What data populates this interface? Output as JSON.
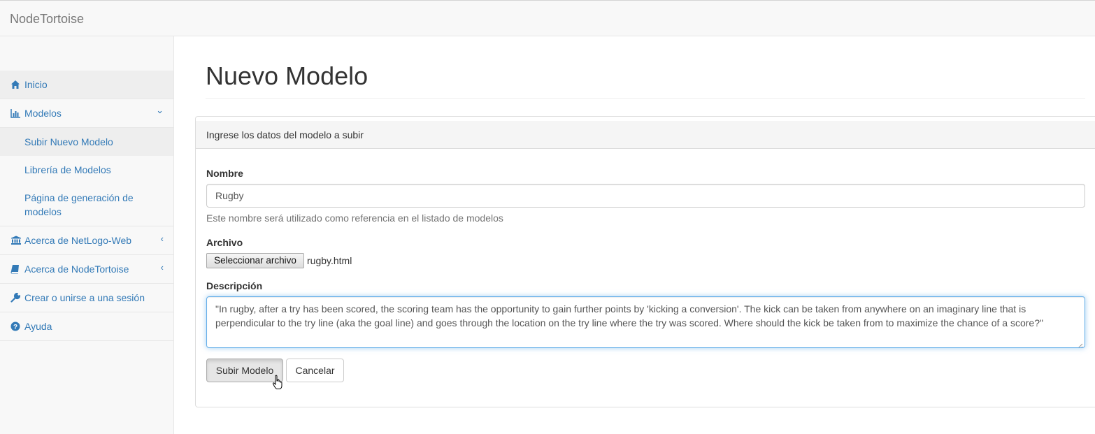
{
  "app": {
    "brand": "NodeTortoise"
  },
  "sidebar": {
    "items": [
      {
        "label": "Inicio",
        "icon": "home-icon"
      },
      {
        "label": "Modelos",
        "icon": "bar-chart-icon"
      },
      {
        "label": "Subir Nuevo Modelo"
      },
      {
        "label": "Librería de Modelos"
      },
      {
        "label": "Página de generación de",
        "label2": "modelos"
      },
      {
        "label": "Acerca de NetLogo-Web",
        "icon": "bank-icon"
      },
      {
        "label": "Acerca de NodeTortoise",
        "icon": "book-icon"
      },
      {
        "label": "Crear o unirse a una sesión",
        "icon": "wrench-icon"
      },
      {
        "label": "Ayuda",
        "icon": "question-circle-icon"
      }
    ],
    "arrows": {
      "expanded": "⌄",
      "collapsed": "‹"
    }
  },
  "main": {
    "title": "Nuevo Modelo",
    "panel_heading": "Ingrese los datos del modelo a subir",
    "form": {
      "name_label": "Nombre",
      "name_value": "Rugby",
      "name_help": "Este nombre será utilizado como referencia en el listado de modelos",
      "file_label": "Archivo",
      "file_button": "Seleccionar archivo",
      "file_name": "rugby.html",
      "desc_label": "Descripción",
      "desc_value": "\"In rugby, after a try has been scored, the scoring team has the opportunity to gain further points by 'kicking a conversion'. The kick can be taken from anywhere on an imaginary line that is perpendicular to the try line (aka the goal line) and goes through the location on the try line where the try was scored. Where should the kick be taken from to maximize the chance of a score?\"",
      "submit_label": "Subir Modelo",
      "cancel_label": "Cancelar"
    }
  },
  "colors": {
    "link": "#337ab7",
    "sidebar_bg": "#f8f8f8",
    "active_bg": "#eeeeee",
    "focus": "#66afe9"
  }
}
